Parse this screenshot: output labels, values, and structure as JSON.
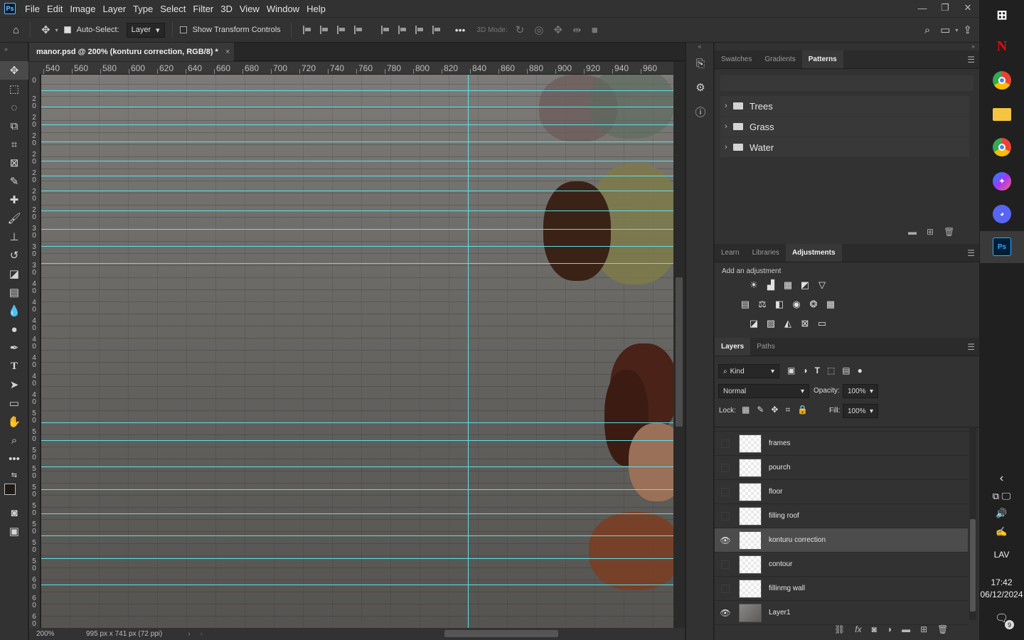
{
  "menubar": {
    "logo": "Ps",
    "items": [
      "File",
      "Edit",
      "Image",
      "Layer",
      "Type",
      "Select",
      "Filter",
      "3D",
      "View",
      "Window",
      "Help"
    ]
  },
  "window_controls": {
    "minimize": "—",
    "restore": "❐",
    "close": "✕"
  },
  "options_bar": {
    "auto_select_label": "Auto-Select:",
    "auto_select_target": "Layer",
    "show_transform_label": "Show Transform Controls",
    "more": "•••",
    "mode_3d_label": "3D Mode:"
  },
  "document": {
    "tab_title": "manor.psd @ 200% (konturu correction, RGB/8) *",
    "close": "×"
  },
  "ruler_top": [
    "540",
    "560",
    "580",
    "600",
    "620",
    "640",
    "660",
    "680",
    "700",
    "720",
    "740",
    "760",
    "780",
    "800",
    "820",
    "840",
    "860",
    "880",
    "900",
    "920",
    "940",
    "960"
  ],
  "ruler_left": [
    "0",
    "20",
    "20",
    "20",
    "20",
    "20",
    "20",
    "20",
    "30",
    "30",
    "30",
    "40",
    "40",
    "40",
    "40",
    "40",
    "40",
    "40",
    "50",
    "50",
    "50",
    "50",
    "50",
    "50",
    "50",
    "50",
    "50",
    "60",
    "60",
    "60"
  ],
  "statusbar": {
    "zoom": "200%",
    "doc_info": "995 px x 741 px (72 ppi)"
  },
  "patterns_panel": {
    "tabs": [
      "Swatches",
      "Gradients",
      "Patterns"
    ],
    "active_tab": "Patterns",
    "groups": [
      "Trees",
      "Grass",
      "Water"
    ]
  },
  "adjustments_panel": {
    "tabs": [
      "Learn",
      "Libraries",
      "Adjustments"
    ],
    "active_tab": "Adjustments",
    "heading": "Add an adjustment"
  },
  "layers_panel": {
    "tabs": [
      "Layers",
      "Paths"
    ],
    "active_tab": "Layers",
    "filter_kind": "Kind",
    "blend_mode": "Normal",
    "opacity_label": "Opacity:",
    "opacity": "100%",
    "lock_label": "Lock:",
    "fill_label": "Fill:",
    "fill": "100%",
    "layers": [
      {
        "name": "frames",
        "visible": false
      },
      {
        "name": "pourch",
        "visible": false
      },
      {
        "name": "floor",
        "visible": false
      },
      {
        "name": "filling roof",
        "visible": false
      },
      {
        "name": "konturu correction",
        "visible": true,
        "selected": true
      },
      {
        "name": "contour",
        "visible": false
      },
      {
        "name": "fillinmg wall",
        "visible": false
      },
      {
        "name": "Layer1",
        "visible": true
      }
    ]
  },
  "taskbar": {
    "language": "LAV",
    "time": "17:42",
    "date": "06/12/2024",
    "notifications": "9",
    "apps": [
      "windows-start",
      "netflix",
      "chrome",
      "file-explorer",
      "chrome-profile",
      "messenger",
      "discord",
      "photoshop"
    ]
  },
  "colors": {
    "guide": "#5fe0e6",
    "panel_bg": "#323232",
    "dark_bg": "#252525"
  }
}
